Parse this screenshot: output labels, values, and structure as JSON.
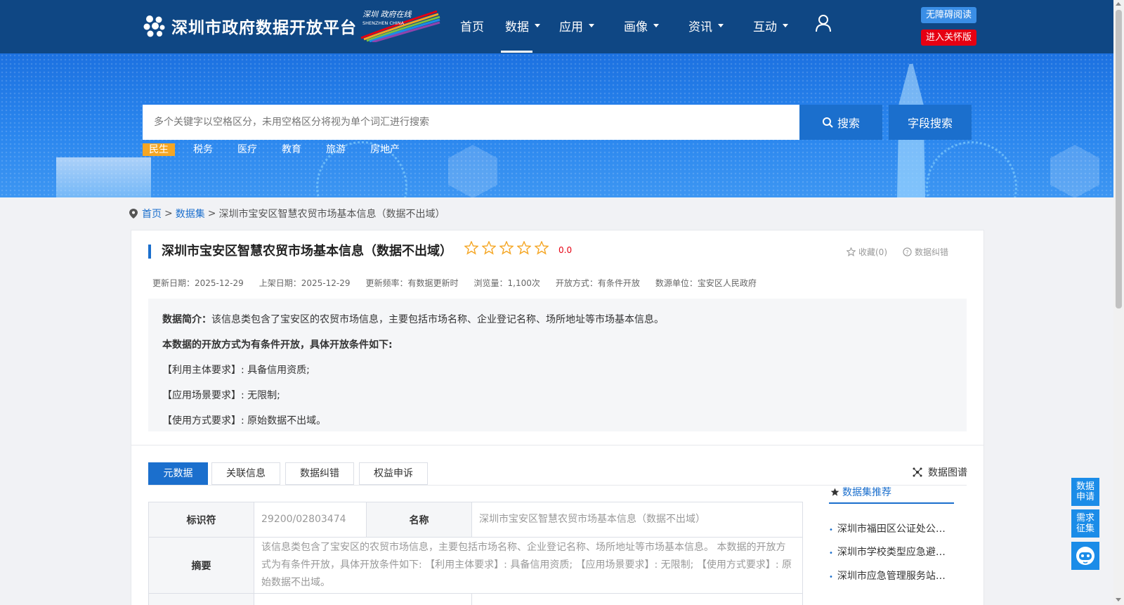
{
  "site": {
    "title": "深圳市政府数据开放平台",
    "city_logo_text": "深圳 政府在线",
    "city_logo_sub": "SHENZHEN CHINA"
  },
  "nav": {
    "items": [
      {
        "label": "首页",
        "dropdown": false
      },
      {
        "label": "数据",
        "dropdown": true,
        "active": true
      },
      {
        "label": "应用",
        "dropdown": true
      },
      {
        "label": "画像",
        "dropdown": true
      },
      {
        "label": "资讯",
        "dropdown": true
      },
      {
        "label": "互动",
        "dropdown": true
      }
    ],
    "accessibility_button": "无障碍阅读",
    "care_mode_button": "进入关怀版"
  },
  "search": {
    "placeholder": "多个关键字以空格区分，未用空格区分将视为单个词汇进行搜索",
    "search_button": "搜索",
    "field_search_button": "字段搜索",
    "tags": [
      "民生",
      "税务",
      "医疗",
      "教育",
      "旅游",
      "房地产"
    ],
    "active_tag": "民生"
  },
  "breadcrumb": {
    "home": "首页",
    "sep": ">",
    "dataset": "数据集",
    "current": "深圳市宝安区智慧农贸市场基本信息（数据不出域）"
  },
  "dataset": {
    "title": "深圳市宝安区智慧农贸市场基本信息（数据不出域）",
    "rating_value": "0.0",
    "stars": 0,
    "favorite": "收藏(0)",
    "correction": "数据纠错",
    "meta": [
      "更新日期：2025-12-29",
      "上架日期：2025-12-29",
      "更新频率：有数据更新时",
      "浏览量：1,100次",
      "开放方式：有条件开放",
      "数源单位：宝安区人民政府"
    ],
    "summary_label": "数据简介：",
    "summary": "该信息类包含了宝安区的农贸市场信息，主要包括市场名称、企业登记名称、场所地址等市场基本信息。",
    "open_condition": "本数据的开放方式为有条件开放，具体开放条件如下:",
    "req1": "【利用主体要求】: 具备信用资质;",
    "req2": "【应用场景要求】: 无限制;",
    "req3": "【使用方式要求】: 原始数据不出域。"
  },
  "tabs": {
    "items": [
      "元数据",
      "关联信息",
      "数据纠错",
      "权益申诉"
    ],
    "active": "元数据",
    "graph_link": "数据图谱"
  },
  "table": {
    "id_label": "标识符",
    "id_value": "29200/02803474",
    "name_label": "名称",
    "name_value": "深圳市宝安区智慧农贸市场基本信息（数据不出域）",
    "abstract_label": "摘要",
    "abstract_value": "该信息类包含了宝安区的农贸市场信息，主要包括市场名称、企业登记名称、场所地址等市场基本信息。 本数据的开放方式为有条件开放，具体开放条件如下: 【利用主体要求】: 具备信用资质; 【应用场景要求】: 无限制; 【使用方式要求】: 原始数据不出域。"
  },
  "recommend": {
    "title": "数据集推荐",
    "items": [
      "深圳市福田区公证处公证...",
      "深圳市学校类型应急避难...",
      "深圳市应急管理服务站信息"
    ]
  },
  "float": {
    "apply": "数据申请",
    "demand": "需求征集"
  },
  "colors": {
    "nav_bg": "#0f4784",
    "primary": "#1b6fcd",
    "active_tag": "#f5a623",
    "care_btn": "#e60012",
    "access_btn": "#3a8ee6"
  }
}
